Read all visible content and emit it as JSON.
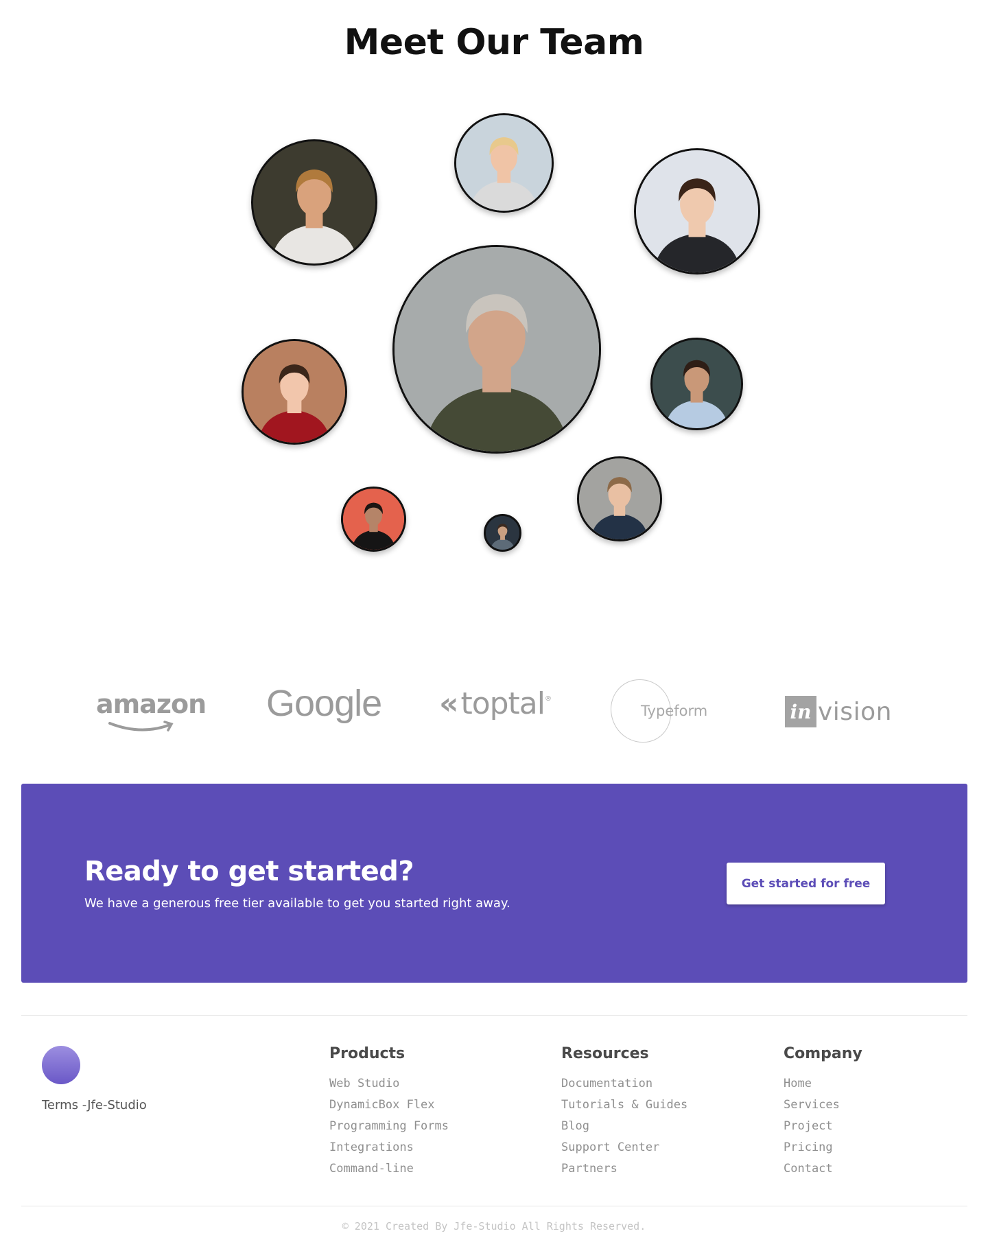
{
  "team": {
    "title": "Meet Our Team",
    "members": [
      {
        "id": "bearded-glasses",
        "shape": "person",
        "bg": "#3d3b2f",
        "skin": "#d9a27c",
        "hair": "#b07a3c",
        "shirt": "#e8e6e3"
      },
      {
        "id": "beanie-woman",
        "shape": "person",
        "bg": "#c9d4dc",
        "skin": "#f0c4a6",
        "hair": "#e8c98c",
        "shirt": "#dadada"
      },
      {
        "id": "young-man-dark-shirt",
        "shape": "person",
        "bg": "#dfe3ea",
        "skin": "#efc9ae",
        "hair": "#3a2418",
        "shirt": "#25262a"
      },
      {
        "id": "lead-man-glasses",
        "shape": "person",
        "bg": "#a7abab",
        "skin": "#d2a58a",
        "hair": "#c9c4bd",
        "shirt": "#454a36"
      },
      {
        "id": "smiling-woman-red",
        "shape": "person",
        "bg": "#b98060",
        "skin": "#f2c6ac",
        "hair": "#3b261a",
        "shirt": "#a1161f"
      },
      {
        "id": "man-light-blue-shirt",
        "shape": "person",
        "bg": "#3c4d4d",
        "skin": "#c99878",
        "hair": "#2e1e16",
        "shirt": "#b6cbe2"
      },
      {
        "id": "man-red-backdrop",
        "shape": "person",
        "bg": "#e4624d",
        "skin": "#b58468",
        "hair": "#1c1512",
        "shirt": "#151515"
      },
      {
        "id": "small-avatar",
        "shape": "person",
        "bg": "#2b3540",
        "skin": "#caa082",
        "hair": "#3c2a20",
        "shirt": "#5d6b78"
      },
      {
        "id": "man-navy-shirt",
        "shape": "person",
        "bg": "#a3a3a0",
        "skin": "#e9c0a3",
        "hair": "#8d6a48",
        "shirt": "#233246"
      }
    ]
  },
  "logos": {
    "amazon": "amazon",
    "google": "Google",
    "toptal": "toptal",
    "toptal_mark": "«",
    "typeform": "Typeform",
    "invision_box": "in",
    "invision_rest": "vision"
  },
  "cta": {
    "title": "Ready to get started?",
    "subtitle": "We have a generous free tier available to get you started right away.",
    "button": "Get started for free",
    "background": "#5c4db7"
  },
  "footer": {
    "brand_link": "Terms -Jfe-Studio",
    "products": {
      "heading": "Products",
      "items": [
        "Web Studio",
        "DynamicBox Flex",
        "Programming Forms",
        "Integrations",
        "Command-line"
      ]
    },
    "resources": {
      "heading": "Resources",
      "items": [
        "Documentation",
        "Tutorials & Guides",
        "Blog",
        "Support Center",
        "Partners"
      ]
    },
    "company": {
      "heading": "Company",
      "items": [
        "Home",
        "Services",
        "Project",
        "Pricing",
        "Contact"
      ]
    },
    "copyright": "© 2021 Created By Jfe-Studio All Rights Reserved."
  }
}
